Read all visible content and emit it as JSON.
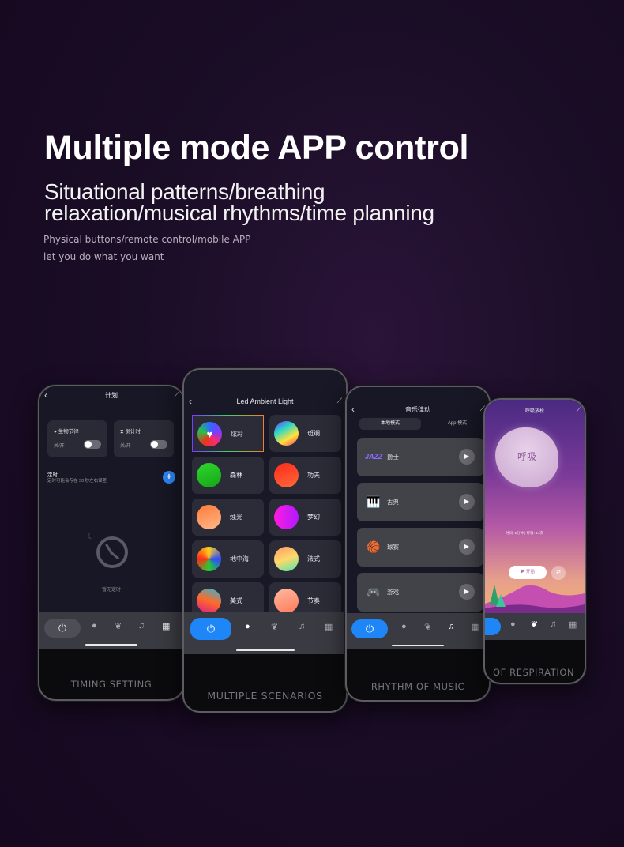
{
  "hero": {
    "title": "Multiple mode APP control",
    "subtitle_line1": "Situational patterns/breathing",
    "subtitle_line2": "relaxation/musical rhythms/time planning",
    "small_line1": "Physical buttons/remote control/mobile APP",
    "small_line2": "let you do what you want"
  },
  "icons": {
    "back": "‹",
    "edit": "⟋",
    "power": "⏻",
    "bulb": "●",
    "leaf": "❦",
    "music": "♫",
    "schedule": "▦",
    "plus": "+",
    "play": "▶",
    "clock": "🕒"
  },
  "colors": {
    "accent_blue": "#1e86f7",
    "card_dark": "#2c2c38",
    "tabbar": "#3a3b42"
  },
  "phones": {
    "timing": {
      "header": "计划",
      "cards": [
        {
          "label": "生物节律",
          "icon": "◕",
          "state": "关/开"
        },
        {
          "label": "倒计时",
          "icon": "⧗",
          "state": "关/开"
        }
      ],
      "timer_title": "定时",
      "timer_note": "定时可能会存在 30 秒左右误差",
      "empty_text": "暂无定时",
      "caption": "TIMING SETTING"
    },
    "scenarios": {
      "header": "Led Ambient Light",
      "scenes": [
        {
          "name": "炫彩",
          "selected": true
        },
        {
          "name": "斑斓"
        },
        {
          "name": "森林"
        },
        {
          "name": "功夫"
        },
        {
          "name": "烛光"
        },
        {
          "name": "梦幻"
        },
        {
          "name": "地中海"
        },
        {
          "name": "法式"
        },
        {
          "name": "美式"
        },
        {
          "name": "节奏"
        }
      ],
      "caption": "MULTIPLE SCENARIOS"
    },
    "music": {
      "header": "音乐律动",
      "tabs": [
        "本地模式",
        "App 模式"
      ],
      "items": [
        {
          "name": "爵士",
          "icon": "JAZZ"
        },
        {
          "name": "古典",
          "icon": "🎹"
        },
        {
          "name": "球赛",
          "icon": "🏀"
        },
        {
          "name": "游戏",
          "icon": "🎮"
        }
      ],
      "caption": "RHYTHM OF MUSIC"
    },
    "breathing": {
      "header": "呼吸放松",
      "blob_label": "呼吸",
      "stats": "时间: 2分钟 | 呼吸: 14次",
      "start_label": "▶ 开始",
      "adjust_icon": "⇄",
      "caption": "OF RESPIRATION"
    }
  }
}
